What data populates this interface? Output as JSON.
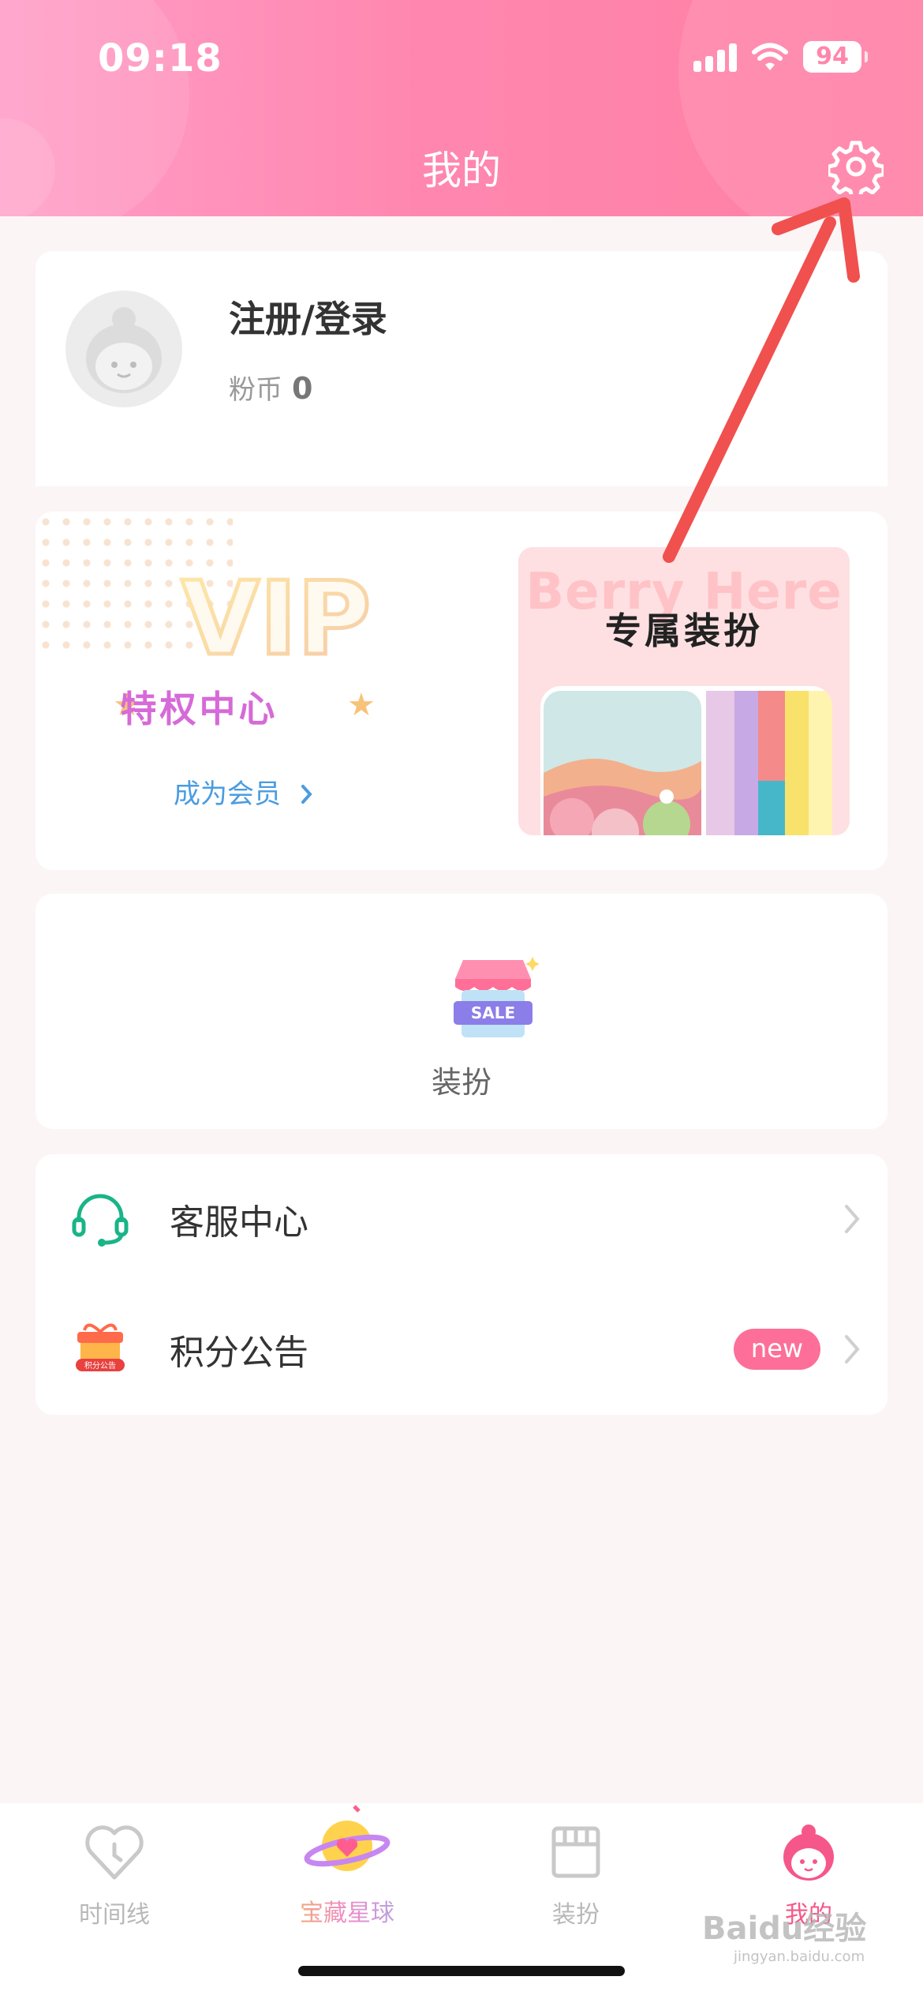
{
  "status_bar": {
    "time": "09:18",
    "battery": "94"
  },
  "header": {
    "title": "我的"
  },
  "profile": {
    "login_label": "注册/登录",
    "coins_label": "粉币",
    "coins_value": "0"
  },
  "vip": {
    "logo_text": "VIP",
    "subtitle": "特权中心",
    "member_link": "成为会员",
    "banner_brand": "Berry Here",
    "banner_title": "专属装扮"
  },
  "dressup": {
    "badge_text": "SALE",
    "label": "装扮"
  },
  "menu": {
    "items": [
      {
        "label": "客服中心",
        "icon": "headset-icon"
      },
      {
        "label": "积分公告",
        "icon": "points-gift-icon",
        "badge": "new",
        "icon_text": "积分公告"
      }
    ]
  },
  "tabbar": {
    "items": [
      {
        "label": "时间线",
        "icon": "heart-clock-icon",
        "active": false
      },
      {
        "label": "宝藏星球",
        "icon": "planet-heart-icon",
        "active": false
      },
      {
        "label": "装扮",
        "icon": "storefront-icon",
        "active": false
      },
      {
        "label": "我的",
        "icon": "girl-avatar-icon",
        "active": true
      }
    ]
  },
  "watermark": {
    "line1": "Baidu经验",
    "line2": "jingyan.baidu.com"
  },
  "colors": {
    "brand_pink": "#ff86ad",
    "active_tab": "#f5578a",
    "link_blue": "#4a9ce0",
    "new_badge": "#fd6f98"
  }
}
